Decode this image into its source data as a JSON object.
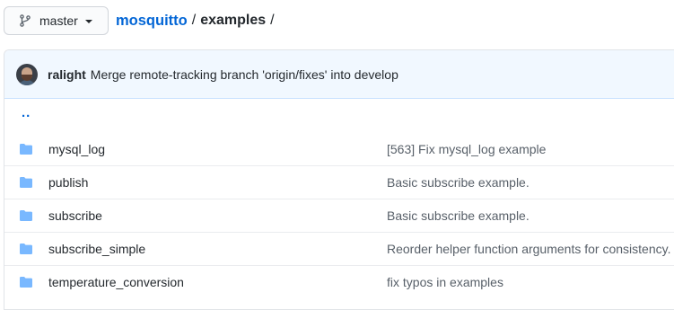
{
  "branch": {
    "name": "master"
  },
  "breadcrumb": {
    "repo": "mosquitto",
    "sep1": "/",
    "current": "examples",
    "sep2": "/"
  },
  "commit": {
    "author": "ralight",
    "message": "Merge remote-tracking branch 'origin/fixes' into develop"
  },
  "parent_link": "..",
  "files": [
    {
      "name": "mysql_log",
      "message": "[563] Fix mysql_log example",
      "icon": "folder-icon"
    },
    {
      "name": "publish",
      "message": "Basic subscribe example.",
      "icon": "folder-icon"
    },
    {
      "name": "subscribe",
      "message": "Basic subscribe example.",
      "icon": "folder-icon"
    },
    {
      "name": "subscribe_simple",
      "message": "Reorder helper function arguments for consistency.",
      "icon": "folder-icon"
    },
    {
      "name": "temperature_conversion",
      "message": "fix typos in examples",
      "icon": "folder-icon"
    }
  ],
  "colors": {
    "link": "#0366d6",
    "folder": "#79b8ff",
    "header_bg": "#f1f8ff"
  }
}
